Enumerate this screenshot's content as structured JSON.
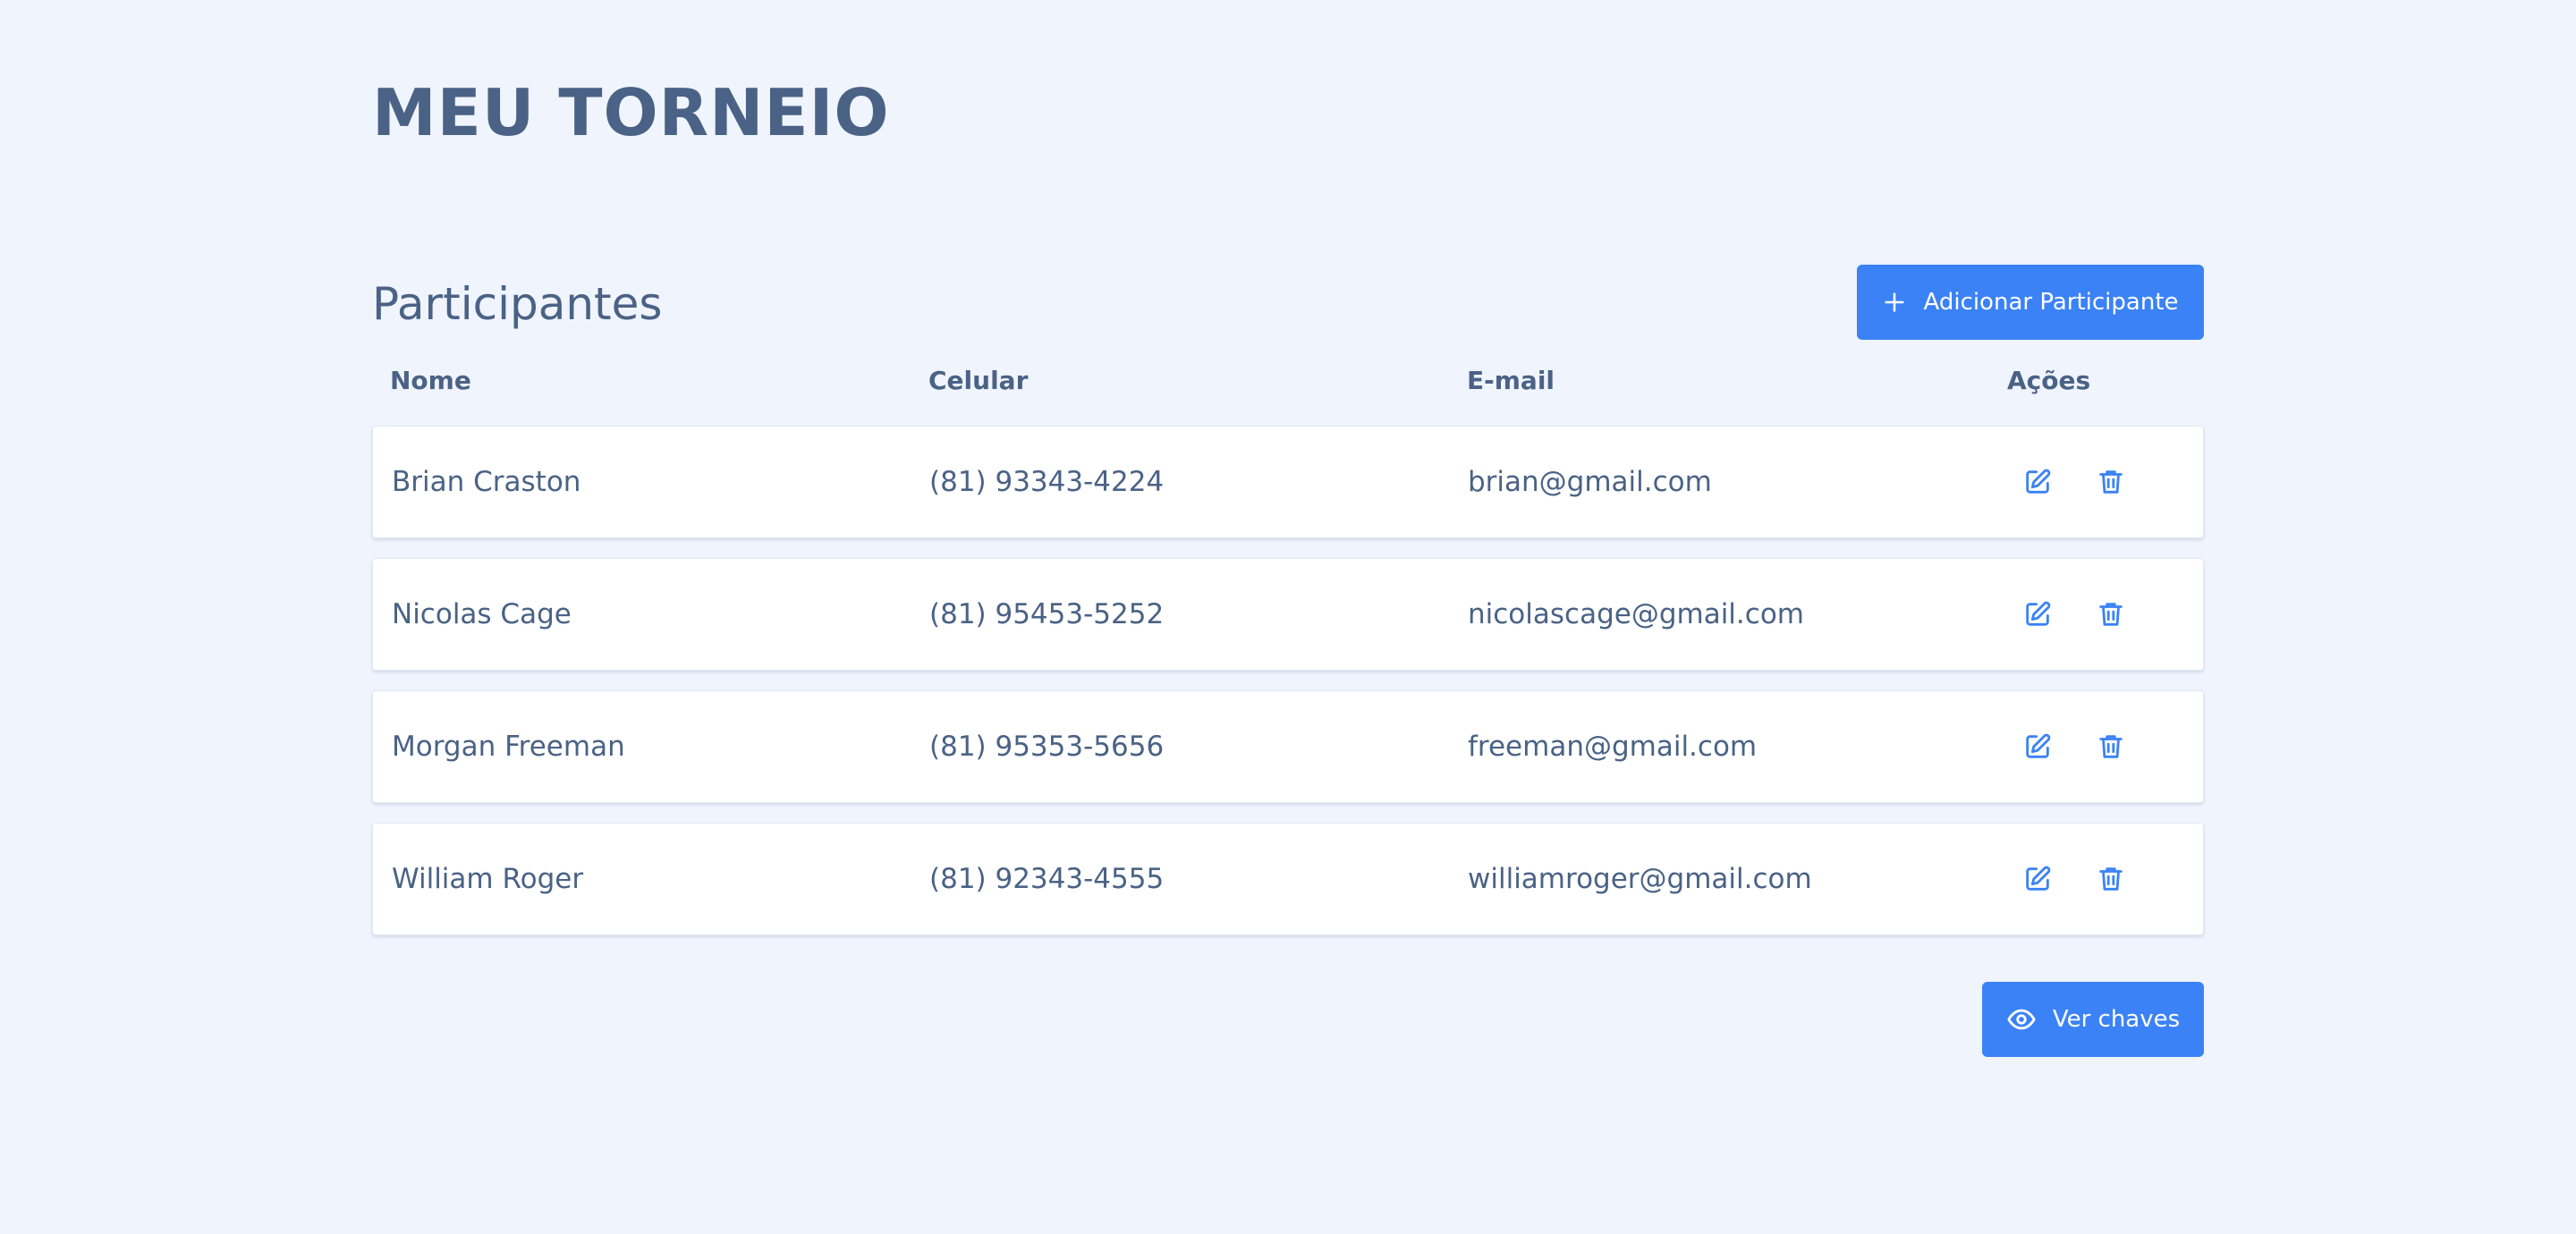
{
  "page": {
    "title": "MEU TORNEIO"
  },
  "participants": {
    "section_title": "Participantes",
    "add_button_label": "Adicionar Participante",
    "add_button_icon": "plus-icon",
    "columns": {
      "name": "Nome",
      "phone": "Celular",
      "email": "E-mail",
      "actions": "Ações"
    },
    "rows": [
      {
        "name": "Brian Craston",
        "phone": "(81) 93343-4224",
        "email": "brian@gmail.com"
      },
      {
        "name": "Nicolas Cage",
        "phone": "(81) 95453-5252",
        "email": "nicolascage@gmail.com"
      },
      {
        "name": "Morgan Freeman",
        "phone": "(81) 95353-5656",
        "email": "freeman@gmail.com"
      },
      {
        "name": "William Roger",
        "phone": "(81) 92343-4555",
        "email": "williamroger@gmail.com"
      }
    ],
    "row_action_icons": [
      "edit-icon",
      "trash-icon"
    ]
  },
  "footer": {
    "view_keys_label": "Ver chaves",
    "view_keys_icon": "eye-icon"
  },
  "colors": {
    "background": "#f0f4fd",
    "primary": "#3b82f6",
    "text": "#4a6285",
    "card": "#ffffff"
  }
}
